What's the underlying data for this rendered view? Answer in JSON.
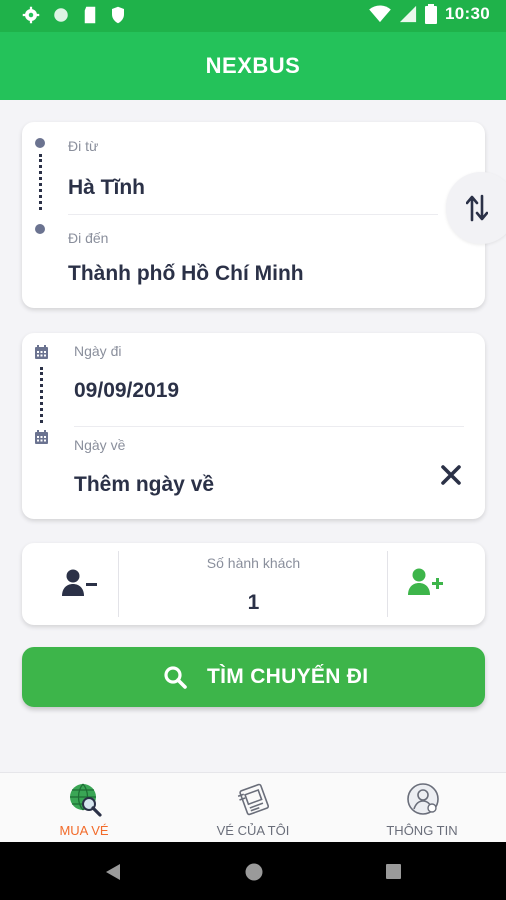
{
  "status_bar": {
    "time": "10:30"
  },
  "app_bar": {
    "title": "NEXBUS"
  },
  "route": {
    "from_label": "Đi từ",
    "from_value": "Hà Tĩnh",
    "to_label": "Đi đến",
    "to_value": "Thành phố Hồ Chí Minh"
  },
  "dates": {
    "depart_label": "Ngày đi",
    "depart_value": "09/09/2019",
    "return_label": "Ngày về",
    "return_value": "Thêm ngày về"
  },
  "passengers": {
    "label": "Số hành khách",
    "count": "1"
  },
  "search_button": {
    "label": "TÌM CHUYẾN ĐI"
  },
  "bottom_nav": {
    "items": [
      {
        "label": "MUA VÉ",
        "icon": "globe-search-icon",
        "active": true
      },
      {
        "label": "VÉ CỦA TÔI",
        "icon": "ticket-icon",
        "active": false
      },
      {
        "label": "THÔNG TIN",
        "icon": "profile-icon",
        "active": false
      }
    ]
  },
  "colors": {
    "primary_green": "#24c25a",
    "button_green": "#3db54a",
    "active_orange": "#f26b2a",
    "text_dark": "#2b3147"
  }
}
